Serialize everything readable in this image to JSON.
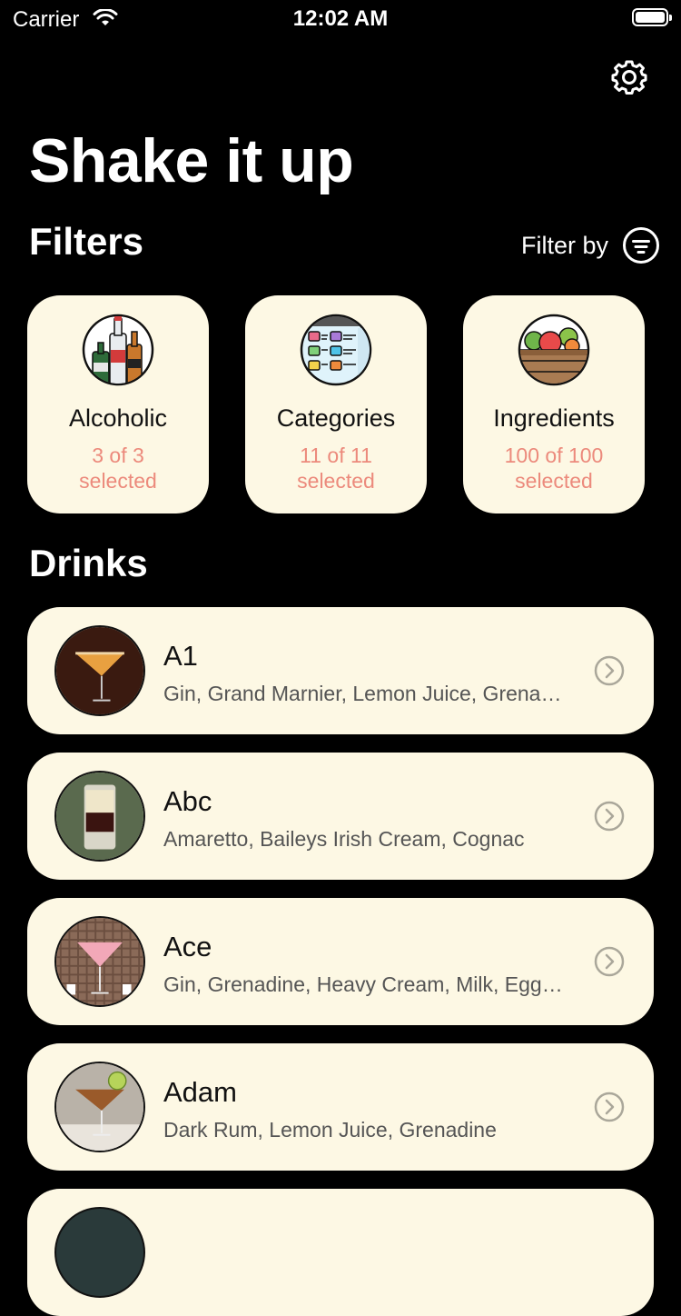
{
  "status_bar": {
    "carrier": "Carrier",
    "time": "12:02 AM"
  },
  "header": {
    "title": "Shake it up"
  },
  "filters": {
    "title": "Filters",
    "filter_by_label": "Filter by",
    "cards": [
      {
        "label": "Alcoholic",
        "count": "3 of 3",
        "status": "selected",
        "icon": "bottles-icon"
      },
      {
        "label": "Categories",
        "count": "11 of 11",
        "status": "selected",
        "icon": "categories-icon"
      },
      {
        "label": "Ingredients",
        "count": "100 of 100",
        "status": "selected",
        "icon": "ingredients-icon"
      }
    ]
  },
  "drinks": {
    "title": "Drinks",
    "items": [
      {
        "name": "A1",
        "ingredients": "Gin, Grand Marnier, Lemon Juice, Grenadine"
      },
      {
        "name": "Abc",
        "ingredients": "Amaretto, Baileys Irish Cream, Cognac"
      },
      {
        "name": "Ace",
        "ingredients": "Gin, Grenadine, Heavy Cream, Milk, Egg White"
      },
      {
        "name": "Adam",
        "ingredients": "Dark Rum, Lemon Juice, Grenadine"
      }
    ]
  },
  "colors": {
    "background": "#000000",
    "card": "#fdf8e4",
    "accent": "#ec8a7c"
  }
}
